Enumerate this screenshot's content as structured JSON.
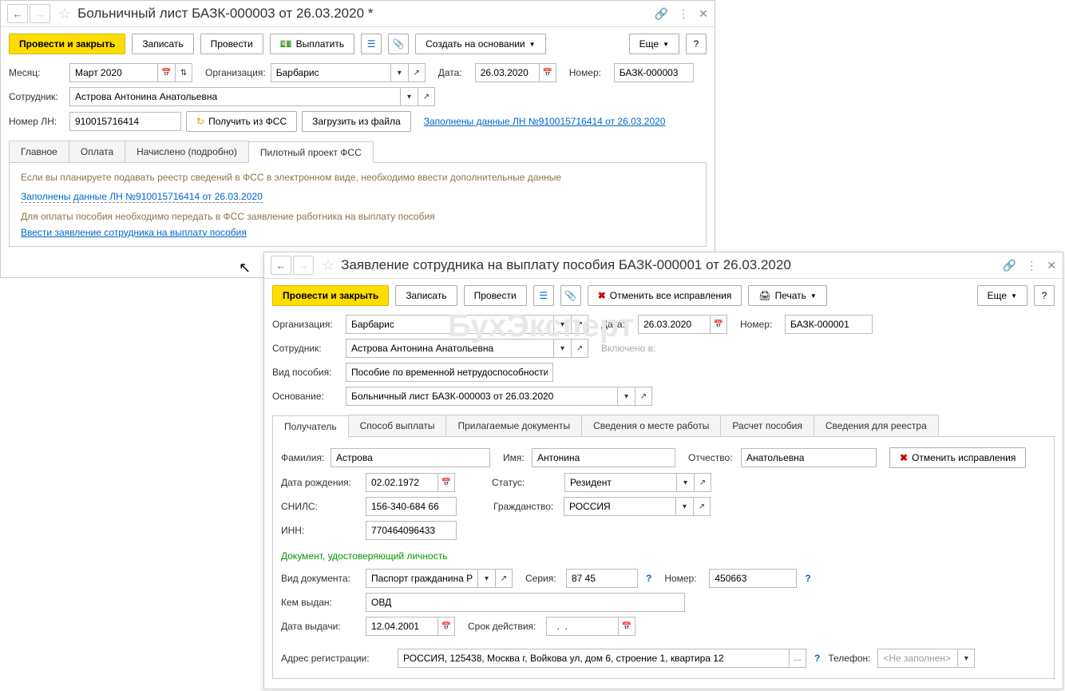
{
  "window1": {
    "title": "Больничный лист БАЗК-000003 от 26.03.2020 *",
    "toolbar": {
      "post_close": "Провести и закрыть",
      "write": "Записать",
      "post": "Провести",
      "pay": "Выплатить",
      "create_based": "Создать на основании",
      "more": "Еще"
    },
    "fields": {
      "month_label": "Месяц:",
      "month": "Март 2020",
      "org_label": "Организация:",
      "org": "Барбарис",
      "date_label": "Дата:",
      "date": "26.03.2020",
      "number_label": "Номер:",
      "number": "БАЗК-000003",
      "employee_label": "Сотрудник:",
      "employee": "Астрова Антонина Анатольевна",
      "ln_label": "Номер ЛН:",
      "ln": "910015716414",
      "get_fss": "Получить из ФСС",
      "load_file": "Загрузить из файла",
      "ln_link": "Заполнены данные ЛН №910015716414 от 26.03.2020"
    },
    "tabs": {
      "main": "Главное",
      "payment": "Оплата",
      "accrued": "Начислено (подробно)",
      "pilot": "Пилотный проект ФСС"
    },
    "content": {
      "info1": "Если вы планируете подавать реестр сведений в ФСС в электронном виде, необходимо ввести дополнительные данные",
      "link1": "Заполнены данные ЛН №910015716414 от 26.03.2020",
      "info2": "Для оплаты пособия необходимо передать в ФСС заявление работника на выплату пособия",
      "link2": "Ввести заявление сотрудника на выплату пособия"
    }
  },
  "window2": {
    "title": "Заявление сотрудника на выплату пособия БАЗК-000001 от 26.03.2020",
    "toolbar": {
      "post_close": "Провести и закрыть",
      "write": "Записать",
      "post": "Провести",
      "cancel_fix": "Отменить все исправления",
      "print": "Печать",
      "more": "Еще"
    },
    "fields": {
      "org_label": "Организация:",
      "org": "Барбарис",
      "date_label": "Дата:",
      "date": "26.03.2020",
      "number_label": "Номер:",
      "number": "БАЗК-000001",
      "employee_label": "Сотрудник:",
      "employee": "Астрова Антонина Анатольевна",
      "included_label": "Включено в:",
      "benefit_type_label": "Вид пособия:",
      "benefit_type": "Пособие по временной нетрудоспособности",
      "basis_label": "Основание:",
      "basis": "Больничный лист БАЗК-000003 от 26.03.2020"
    },
    "tabs": {
      "recipient": "Получатель",
      "pay_method": "Способ выплаты",
      "docs": "Прилагаемые документы",
      "workplace": "Сведения о месте работы",
      "calc": "Расчет пособия",
      "registry": "Сведения для реестра"
    },
    "recipient": {
      "lastname_label": "Фамилия:",
      "lastname": "Астрова",
      "firstname_label": "Имя:",
      "firstname": "Антонина",
      "patronymic_label": "Отчество:",
      "patronymic": "Анатольевна",
      "cancel_fix": "Отменить исправления",
      "birthdate_label": "Дата рождения:",
      "birthdate": "02.02.1972",
      "status_label": "Статус:",
      "status": "Резидент",
      "snils_label": "СНИЛС:",
      "snils": "156-340-684 66",
      "citizenship_label": "Гражданство:",
      "citizenship": "РОССИЯ",
      "inn_label": "ИНН:",
      "inn": "770464096433",
      "doc_header": "Документ, удостоверяющий личность",
      "doctype_label": "Вид документа:",
      "doctype": "Паспорт гражданина Рос",
      "series_label": "Серия:",
      "series": "87 45",
      "docnum_label": "Номер:",
      "docnum": "450663",
      "issued_label": "Кем выдан:",
      "issued": "ОВД",
      "issue_date_label": "Дата выдачи:",
      "issue_date": "12.04.2001",
      "expiry_label": "Срок действия:",
      "expiry": "  .  .    ",
      "address_label": "Адрес регистрации:",
      "address": "РОССИЯ, 125438, Москва г, Войкова ул, дом 6, строение 1, квартира 12",
      "phone_label": "Телефон:",
      "phone": "<Не заполнен>"
    }
  }
}
